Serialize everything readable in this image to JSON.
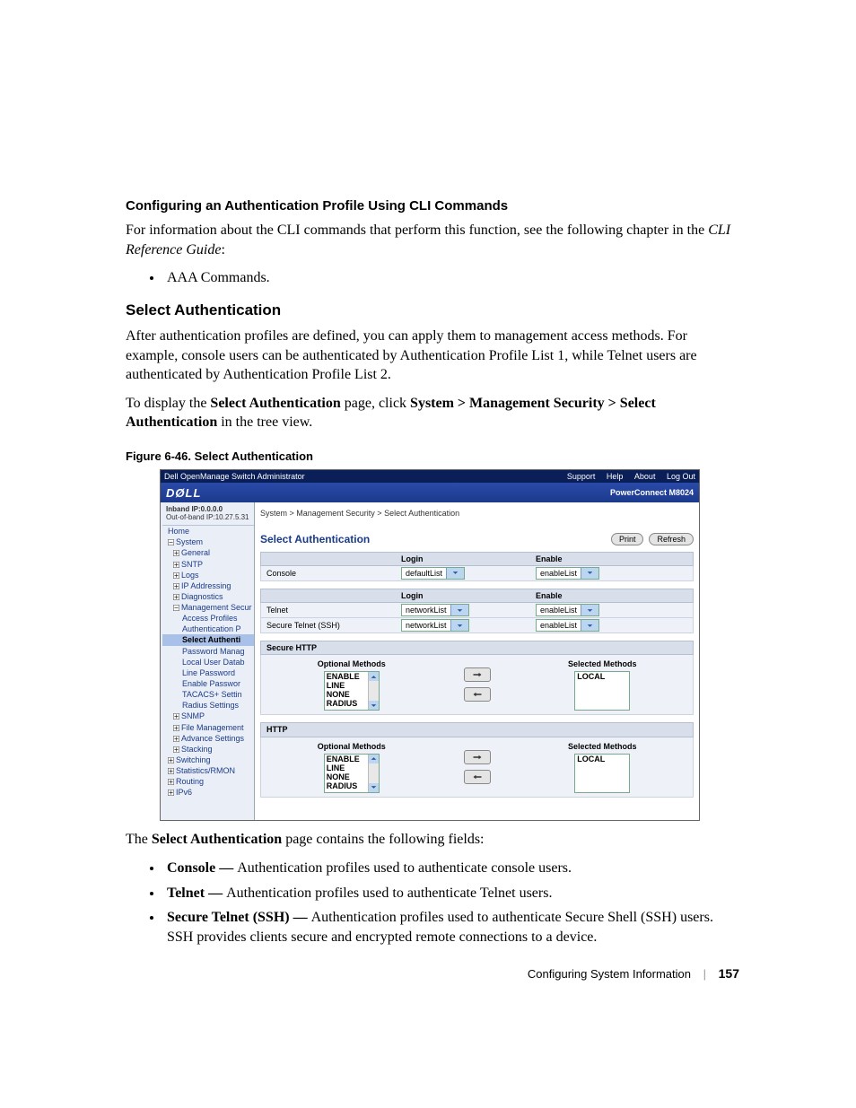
{
  "section1_heading": "Configuring an Authentication Profile Using CLI Commands",
  "section1_para_a": "For information about the CLI commands that perform this function, see the following chapter in the ",
  "section1_para_b": "CLI Reference Guide",
  "section1_para_c": ":",
  "section1_bullet1": "AAA Commands.",
  "section2_heading": "Select Authentication",
  "section2_para1": "After authentication profiles are defined, you can apply them to management access methods. For example, console users can be authenticated by Authentication Profile List 1, while Telnet users are authenticated by Authentication Profile List 2.",
  "section2_para2_a": "To display the ",
  "section2_para2_b": "Select Authentication",
  "section2_para2_c": " page, click ",
  "section2_para2_d": "System > Management Security > Select Authentication",
  "section2_para2_e": " in the tree view.",
  "figure_caption": "Figure 6-46.    Select Authentication",
  "intro_after_figure_a": "The ",
  "intro_after_figure_b": "Select Authentication",
  "intro_after_figure_c": " page contains the following fields:",
  "field_bullets": [
    {
      "term": "Console — ",
      "desc": "Authentication profiles used to authenticate console users."
    },
    {
      "term": "Telnet — ",
      "desc": "Authentication profiles used to authenticate Telnet users."
    },
    {
      "term": "Secure Telnet (SSH) — ",
      "desc": "Authentication profiles used to authenticate Secure Shell (SSH) users. SSH provides clients secure and encrypted remote connections to a device."
    }
  ],
  "footer_chapter": "Configuring System Information",
  "footer_page": "157",
  "shot": {
    "window_title": "Dell OpenManage Switch Administrator",
    "top_links": [
      "Support",
      "Help",
      "About",
      "Log Out"
    ],
    "logo": "DØLL",
    "product": "PowerConnect M8024",
    "ip_line1": "Inband IP:0.0.0.0",
    "ip_line2": "Out-of-band IP:10.27.5.31",
    "tree": [
      {
        "lvl": 0,
        "label": "Home"
      },
      {
        "lvl": 0,
        "label": "System",
        "exp": "-"
      },
      {
        "lvl": 1,
        "label": "General",
        "exp": "+"
      },
      {
        "lvl": 1,
        "label": "SNTP",
        "exp": "+"
      },
      {
        "lvl": 1,
        "label": "Logs",
        "exp": "+"
      },
      {
        "lvl": 1,
        "label": "IP Addressing",
        "exp": "+"
      },
      {
        "lvl": 1,
        "label": "Diagnostics",
        "exp": "+"
      },
      {
        "lvl": 1,
        "label": "Management Secur",
        "exp": "-"
      },
      {
        "lvl": 2,
        "label": "Access Profiles"
      },
      {
        "lvl": 2,
        "label": "Authentication P"
      },
      {
        "lvl": 2,
        "label": "Select Authenti",
        "sel": true
      },
      {
        "lvl": 2,
        "label": "Password Manag"
      },
      {
        "lvl": 2,
        "label": "Local User Datab"
      },
      {
        "lvl": 2,
        "label": "Line Password"
      },
      {
        "lvl": 2,
        "label": "Enable Passwor"
      },
      {
        "lvl": 2,
        "label": "TACACS+ Settin"
      },
      {
        "lvl": 2,
        "label": "Radius Settings"
      },
      {
        "lvl": 1,
        "label": "SNMP",
        "exp": "+"
      },
      {
        "lvl": 1,
        "label": "File Management",
        "exp": "+"
      },
      {
        "lvl": 1,
        "label": "Advance Settings",
        "exp": "+"
      },
      {
        "lvl": 1,
        "label": "Stacking",
        "exp": "+"
      },
      {
        "lvl": 0,
        "label": "Switching",
        "exp": "+"
      },
      {
        "lvl": 0,
        "label": "Statistics/RMON",
        "exp": "+"
      },
      {
        "lvl": 0,
        "label": "Routing",
        "exp": "+"
      },
      {
        "lvl": 0,
        "label": "IPv6",
        "exp": "+"
      }
    ],
    "breadcrumb": "System > Management Security > Select Authentication",
    "page_title": "Select Authentication",
    "btn_print": "Print",
    "btn_refresh": "Refresh",
    "col_login": "Login",
    "col_enable": "Enable",
    "row_console": "Console",
    "console_login": "defaultList",
    "console_enable": "enableList",
    "row_telnet": "Telnet",
    "telnet_login": "networkList",
    "telnet_enable": "enableList",
    "row_ssh": "Secure Telnet (SSH)",
    "ssh_login": "networkList",
    "ssh_enable": "enableList",
    "grp_securehttp": "Secure HTTP",
    "grp_http": "HTTP",
    "lbl_optional": "Optional Methods",
    "lbl_selected": "Selected Methods",
    "opt_methods": [
      "ENABLE",
      "LINE",
      "NONE",
      "RADIUS"
    ],
    "sel_methods": [
      "LOCAL"
    ]
  }
}
